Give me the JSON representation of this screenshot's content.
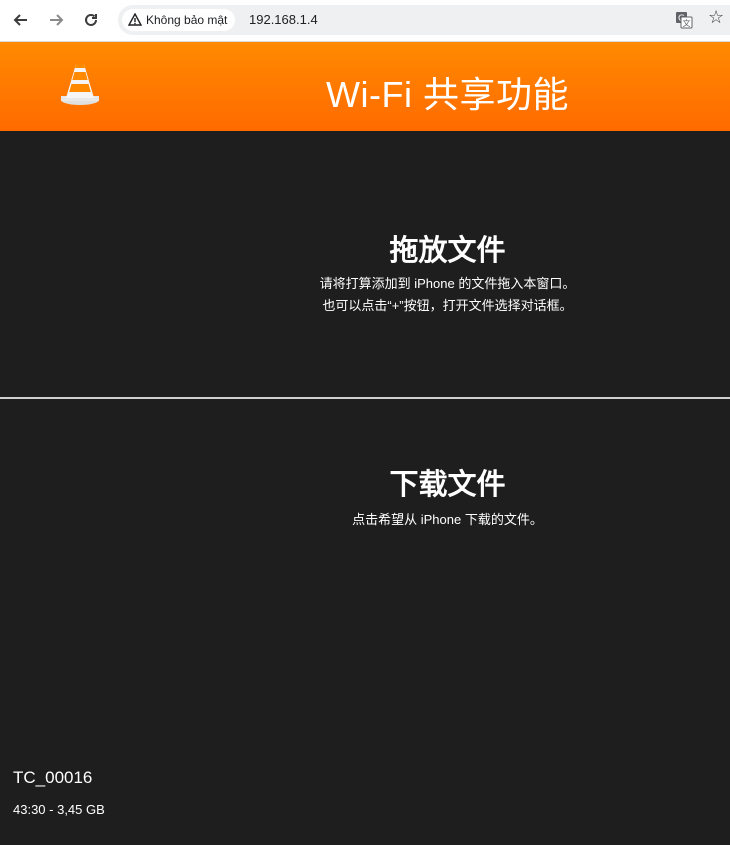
{
  "browser": {
    "security_label": "Không bảo mật",
    "url": "192.168.1.4"
  },
  "header": {
    "title": "Wi-Fi 共享功能",
    "brand_color": "#ff7a00"
  },
  "upload_section": {
    "title": "拖放文件",
    "line1": "请将打算添加到 iPhone 的文件拖入本窗口。",
    "line2": "也可以点击“+”按钮，打开文件选择对话框。"
  },
  "download_section": {
    "title": "下载文件",
    "line1": "点击希望从 iPhone 下载的文件。"
  },
  "files": [
    {
      "name": "TC_00016",
      "meta": "43:30 - 3,45 GB"
    }
  ]
}
